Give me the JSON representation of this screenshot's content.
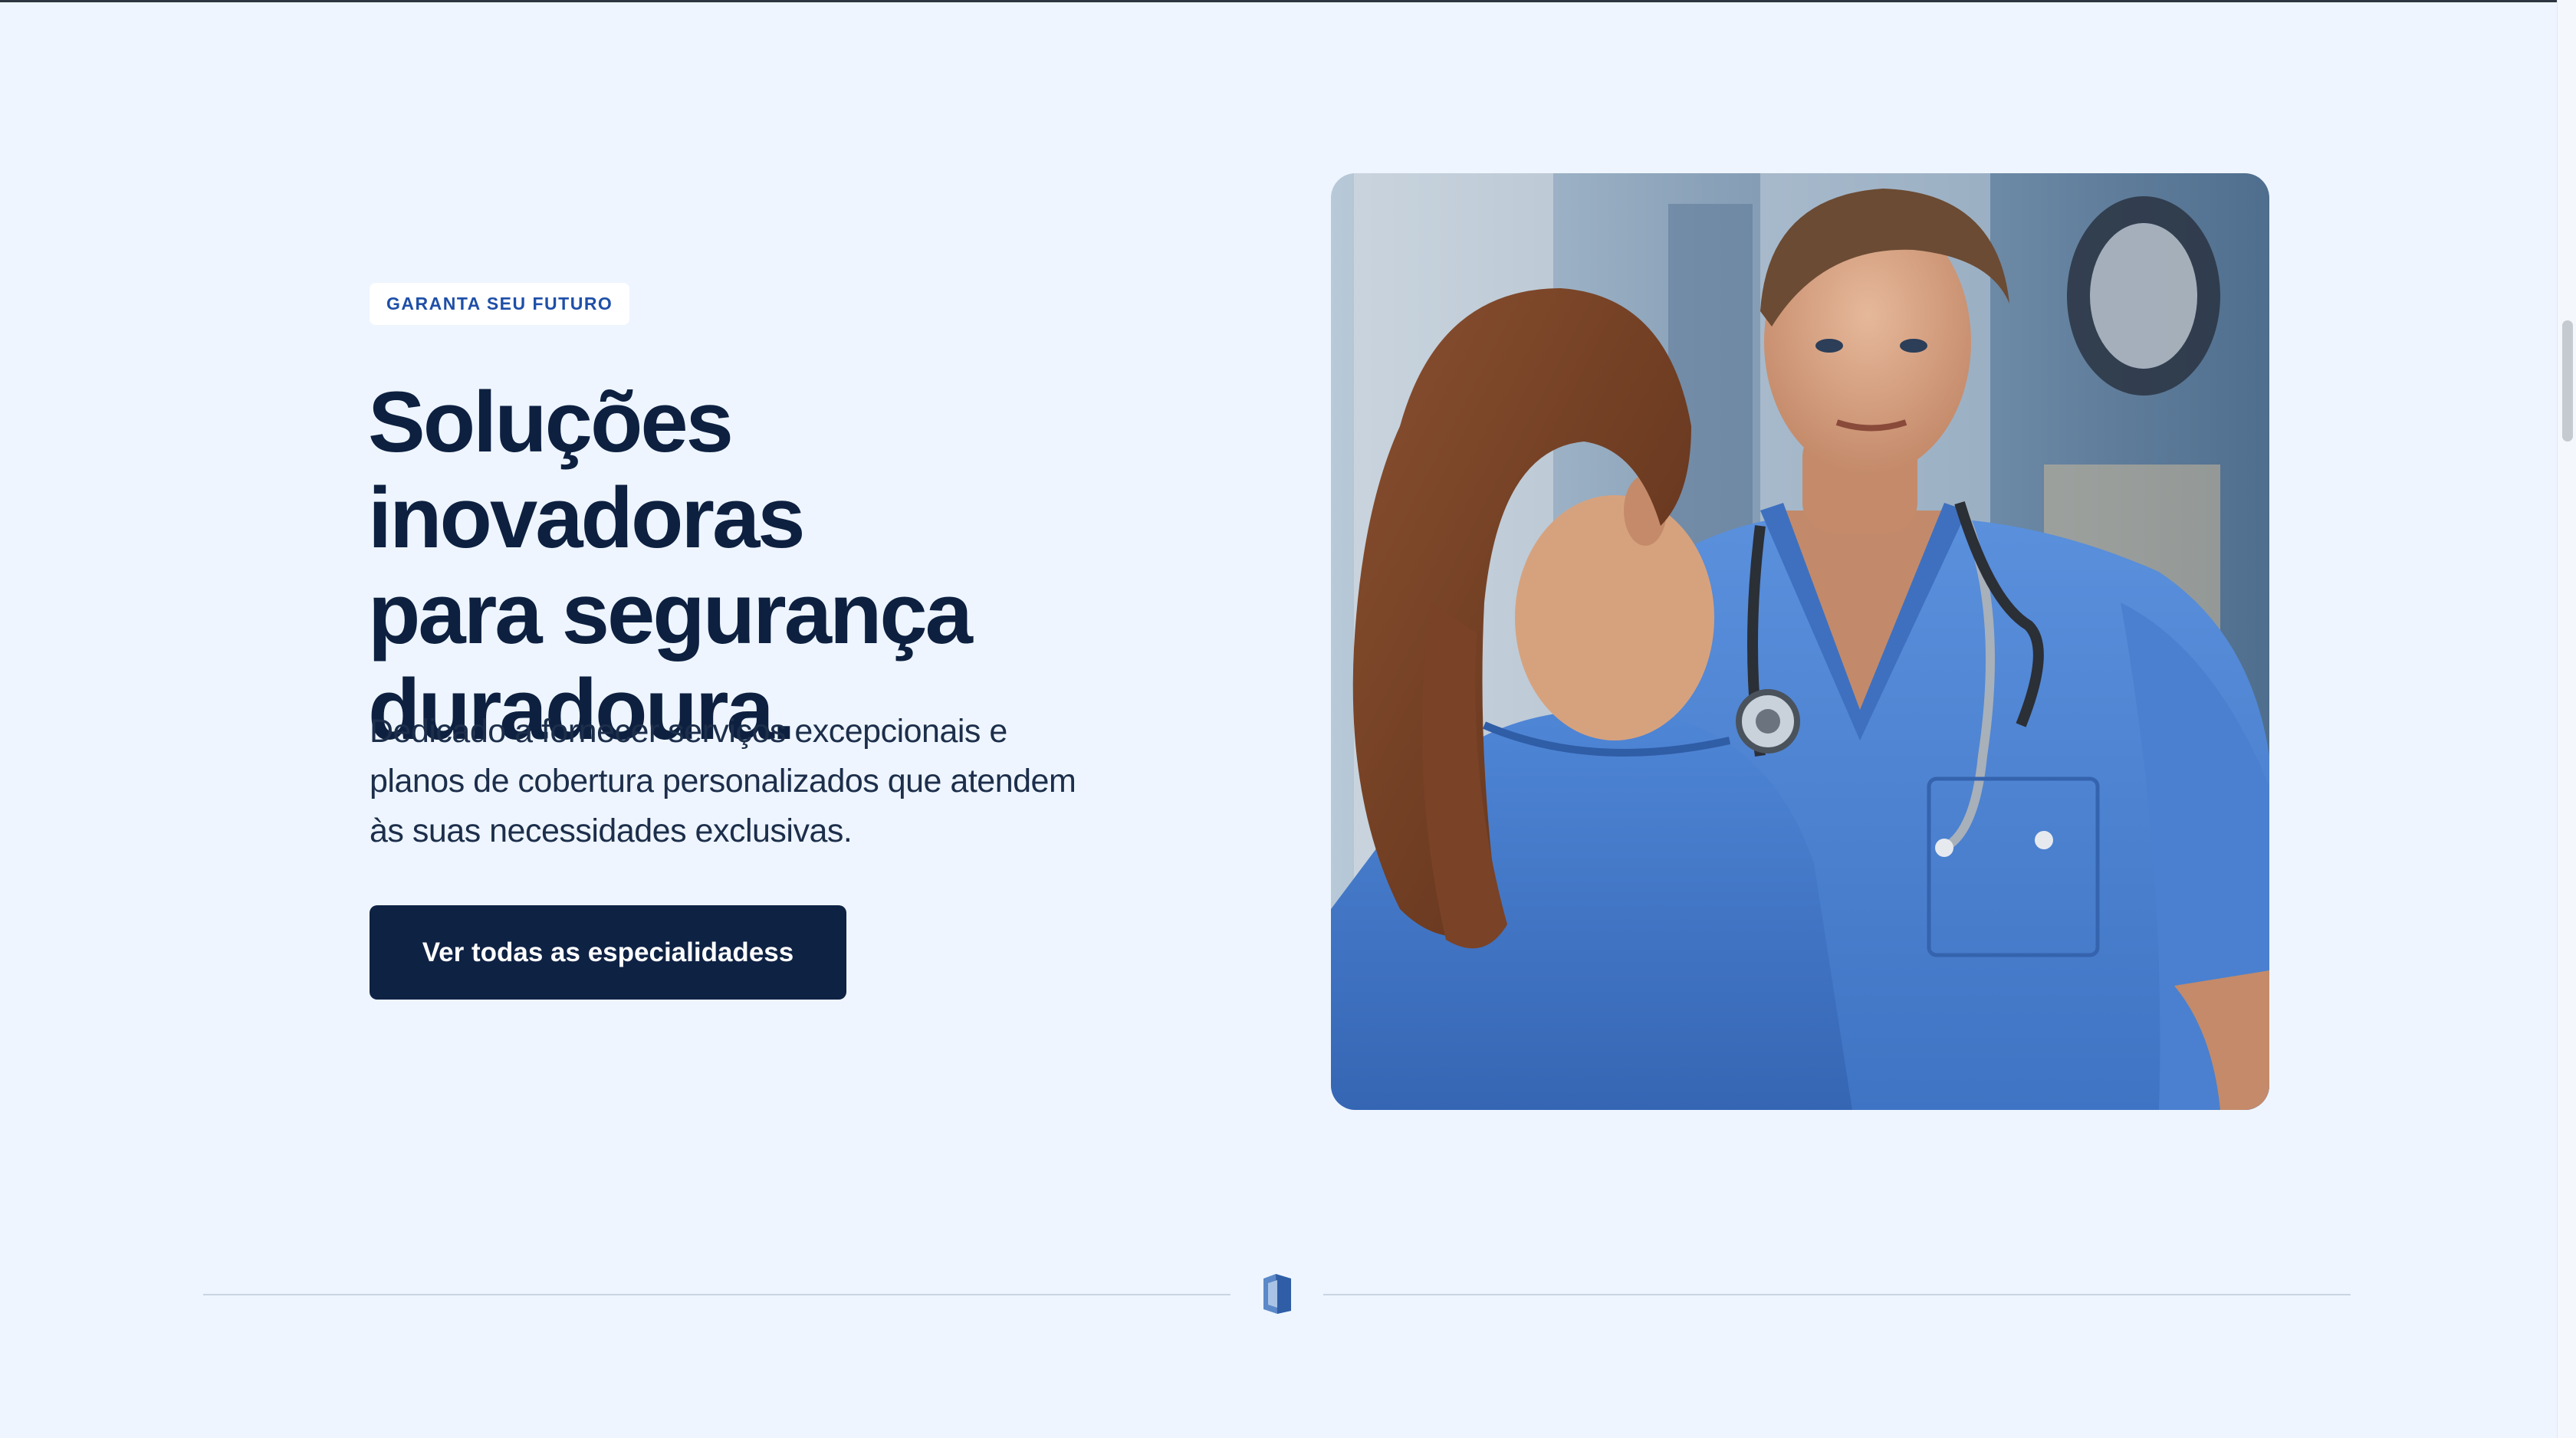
{
  "hero": {
    "eyebrow": "GARANTA SEU FUTURO",
    "headline_lines": [
      "Soluções inovadoras",
      "para segurança",
      "duradoura."
    ],
    "description_lines": [
      "Dedicado a fornecer serviços excepcionais e",
      "planos de cobertura personalizados que atendem",
      "às suas necessidades exclusivas."
    ],
    "cta_label": "Ver todas as especialidadess",
    "image_icon": "doctor-and-nurse-photo"
  },
  "divider": {
    "icon": "shield-icon"
  },
  "colors": {
    "background": "#eef5ff",
    "primary_dark": "#0e2244",
    "accent_blue": "#1e4fa8",
    "scrub_blue": "#4f86d6"
  }
}
